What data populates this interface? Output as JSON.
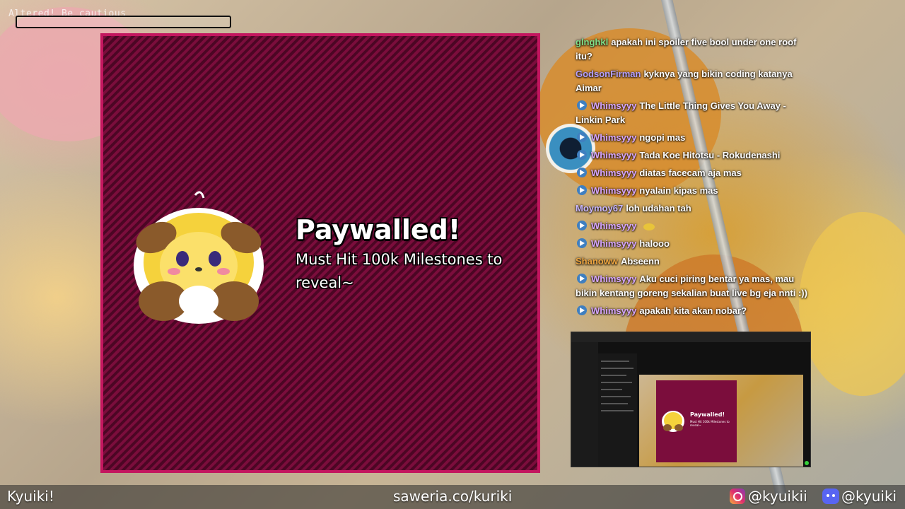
{
  "overlay": {
    "altered_text": "Altered! Be cautious"
  },
  "paywall": {
    "title": "Paywalled!",
    "subtitle": "Must Hit 100k Milestones to reveal~"
  },
  "chat": {
    "messages": [
      {
        "user": "glnghkl",
        "user_color": "#7ee08a",
        "text": "apakah ini spoiler five bool under one roof itu?",
        "badge": false
      },
      {
        "user": "GodsonFirman",
        "user_color": "#b6a0ff",
        "text": "kyknya yang bikin coding katanya Aimar",
        "badge": false
      },
      {
        "user": "Whimsyyy",
        "user_color": "#d7a6ff",
        "text": "The Little Thing Gives You Away - Linkin Park",
        "badge": true
      },
      {
        "user": "Whimsyyy",
        "user_color": "#d7a6ff",
        "text": "ngopi mas",
        "badge": true
      },
      {
        "user": "Whimsyyy",
        "user_color": "#d7a6ff",
        "text": "Tada Koe Hitotsu - Rokudenashi",
        "badge": true
      },
      {
        "user": "Whimsyyy",
        "user_color": "#d7a6ff",
        "text": "diatas facecam aja mas",
        "badge": true
      },
      {
        "user": "Whimsyyy",
        "user_color": "#d7a6ff",
        "text": "nyalain kipas mas",
        "badge": true
      },
      {
        "user": "Moymoy67",
        "user_color": "#c9b7ff",
        "text": "loh udahan tah",
        "badge": false
      },
      {
        "user": "Whimsyyy",
        "user_color": "#d7a6ff",
        "text": "",
        "badge": true,
        "emote": true
      },
      {
        "user": "Whimsyyy",
        "user_color": "#d7a6ff",
        "text": "halooo",
        "badge": true
      },
      {
        "user": "Shanoww",
        "user_color": "#f0a640",
        "text": "Abseenn",
        "badge": false
      },
      {
        "user": "Whimsyyy",
        "user_color": "#d7a6ff",
        "text": "Aku cuci piring bentar ya mas, mau bikin kentang goreng sekalian buat live bg eja nnti :))",
        "badge": true
      },
      {
        "user": "Whimsyyy",
        "user_color": "#d7a6ff",
        "text": "apakah kita akan nobar?",
        "badge": true
      }
    ]
  },
  "preview": {
    "title": "Paywalled!",
    "subtitle": "Must Hit 100k Milestones to reveal~"
  },
  "footer": {
    "left": "Kyuiki!",
    "center": "saweria.co/kuriki",
    "instagram": "@kyuikii",
    "discord": "@kyuiki"
  },
  "icons": {
    "instagram": "instagram-icon",
    "discord": "discord-icon",
    "chat_badge": "play-badge-icon"
  }
}
